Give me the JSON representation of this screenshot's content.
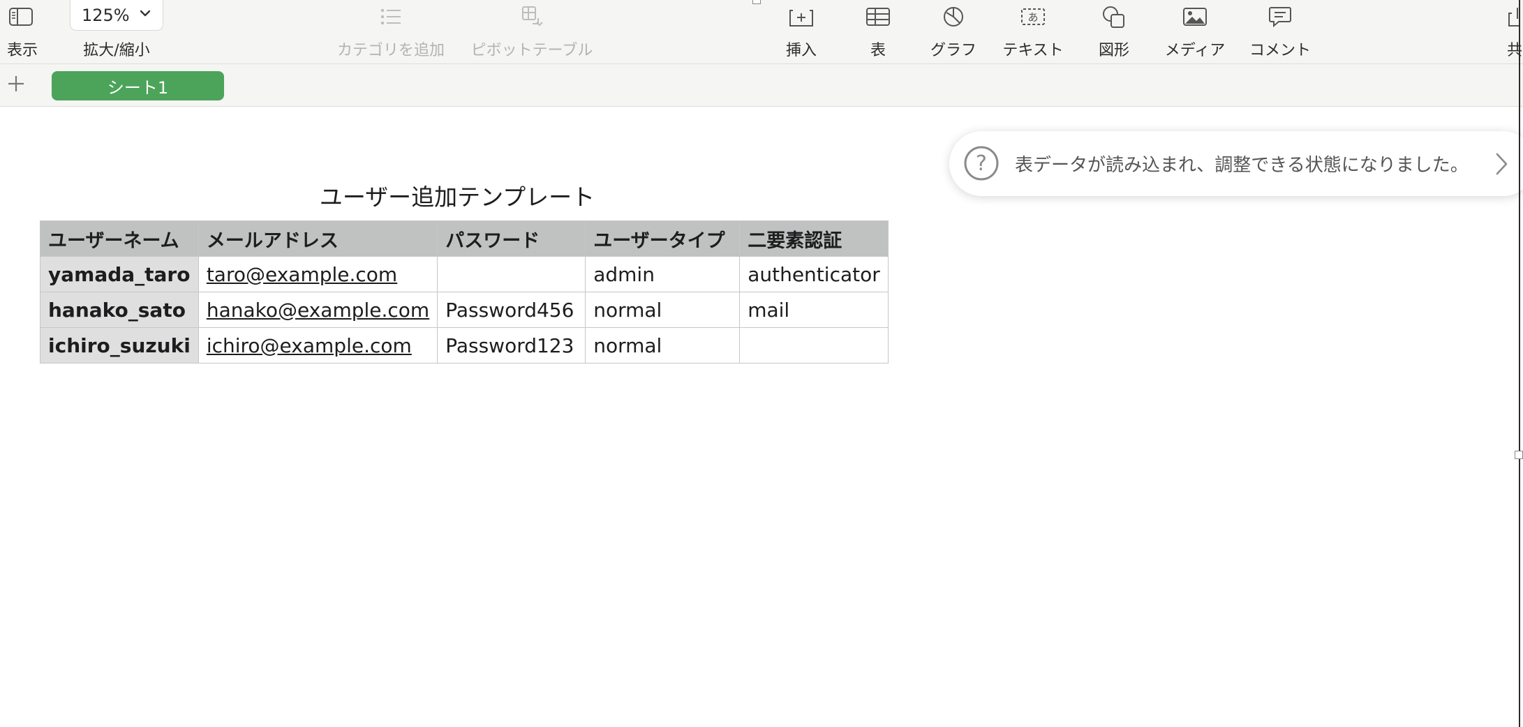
{
  "toolbar": {
    "view_label": "表示",
    "zoom_value": "125%",
    "zoom_label": "拡大/縮小",
    "add_category_label": "カテゴリを追加",
    "pivot_table_label": "ピボットテーブル",
    "insert_label": "挿入",
    "table_label": "表",
    "chart_label": "グラフ",
    "text_label": "テキスト",
    "shape_label": "図形",
    "media_label": "メディア",
    "comment_label": "コメント",
    "share_label": "共"
  },
  "sheets": {
    "active_tab": "シート1"
  },
  "table": {
    "title": "ユーザー追加テンプレート",
    "headers": [
      "ユーザーネーム",
      "メールアドレス",
      "パスワード",
      "ユーザータイプ",
      "二要素認証"
    ],
    "rows": [
      [
        "yamada_taro",
        "taro@example.com",
        "",
        "admin",
        "authenticator"
      ],
      [
        "hanako_sato",
        "hanako@example.com",
        "Password456",
        "normal",
        "mail"
      ],
      [
        "ichiro_suzuki",
        "ichiro@example.com",
        "Password123",
        "normal",
        ""
      ]
    ]
  },
  "notification": {
    "message": "表データが読み込まれ、調整できる状態になりました。"
  },
  "colors": {
    "sheet_tab": "#4ca45a",
    "header_fill": "#c0c2c1",
    "row_header_fill": "#dfdfdf"
  }
}
